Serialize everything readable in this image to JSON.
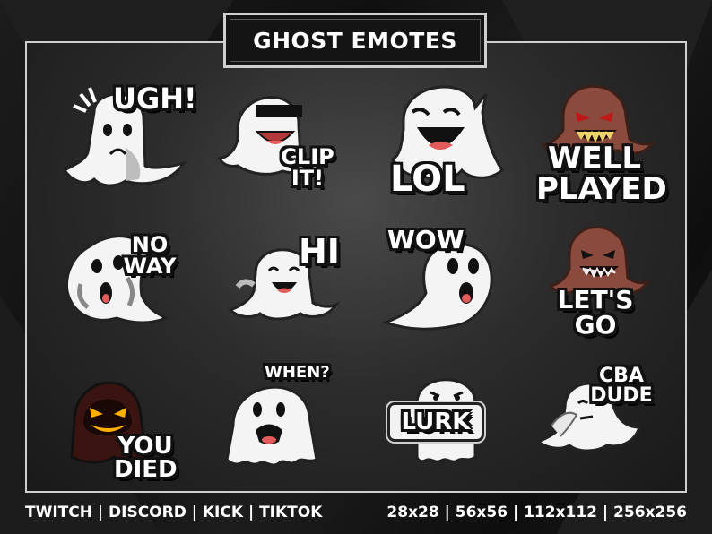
{
  "title": "GHOST EMOTES",
  "emotes": [
    {
      "caption": "UGH!",
      "style": "white",
      "expression": "sad"
    },
    {
      "caption": "CLIP IT!",
      "style": "white",
      "expression": "happy-sunglasses"
    },
    {
      "caption": "LOL",
      "style": "white",
      "expression": "laughing"
    },
    {
      "caption": "WELL PLAYED",
      "style": "brown",
      "expression": "evil-grin"
    },
    {
      "caption": "NO WAY",
      "style": "white",
      "expression": "shocked"
    },
    {
      "caption": "HI",
      "style": "white",
      "expression": "smiling"
    },
    {
      "caption": "WOW",
      "style": "white",
      "expression": "surprised"
    },
    {
      "caption": "LET'S GO",
      "style": "brown",
      "expression": "angry-grin"
    },
    {
      "caption": "YOU DIED",
      "style": "dark-red",
      "expression": "glowing-grin"
    },
    {
      "caption": "WHEN?",
      "style": "white",
      "expression": "worried"
    },
    {
      "caption": "LURK",
      "style": "white",
      "expression": "peeking"
    },
    {
      "caption": "CBA DUDE",
      "style": "white",
      "expression": "facepalm"
    }
  ],
  "footer": {
    "platforms": "TWITCH | DISCORD | KICK | TIKTOK",
    "sizes": "28x28  | 56x56 | 112x112 | 256x256"
  },
  "colors": {
    "ghost_white": "#f4f4f4",
    "ghost_shade": "#bdbdbd",
    "ghost_brown": "#8a4a3e",
    "ghost_dark": "#3a1410",
    "glow": "#ffb000",
    "mouth": "#e25b5b",
    "border": "#cfcfcf"
  }
}
